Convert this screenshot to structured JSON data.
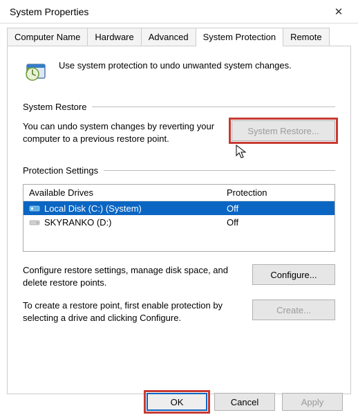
{
  "window": {
    "title": "System Properties"
  },
  "tabs": {
    "computer_name": "Computer Name",
    "hardware": "Hardware",
    "advanced": "Advanced",
    "system_protection": "System Protection",
    "remote": "Remote"
  },
  "intro": "Use system protection to undo unwanted system changes.",
  "system_restore": {
    "label": "System Restore",
    "text": "You can undo system changes by reverting your computer to a previous restore point.",
    "button": "System Restore..."
  },
  "protection_settings": {
    "label": "Protection Settings",
    "columns": {
      "drive": "Available Drives",
      "protection": "Protection"
    },
    "rows": [
      {
        "drive": "Local Disk (C:) (System)",
        "protection": "Off",
        "selected": true
      },
      {
        "drive": "SKYRANKO (D:)",
        "protection": "Off",
        "selected": false
      }
    ],
    "configure_text": "Configure restore settings, manage disk space, and delete restore points.",
    "configure_button": "Configure...",
    "create_text": "To create a restore point, first enable protection by selecting a drive and clicking Configure.",
    "create_button": "Create..."
  },
  "footer": {
    "ok": "OK",
    "cancel": "Cancel",
    "apply": "Apply"
  }
}
